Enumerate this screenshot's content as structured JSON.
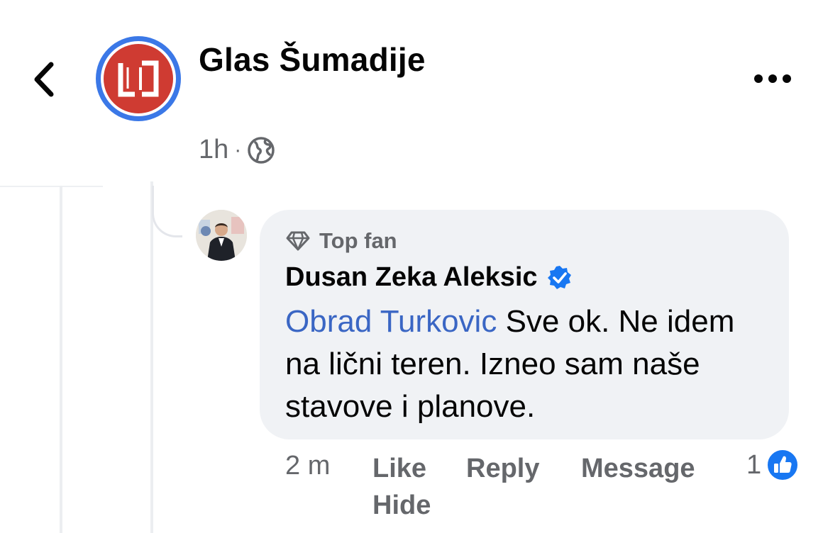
{
  "header": {
    "page_name": "Glas Šumadije",
    "timestamp": "1h",
    "separator": "·",
    "audience_icon": "globe-icon",
    "back_icon": "chevron-left-icon",
    "more_icon": "more-dots-icon"
  },
  "comment": {
    "badge_label": "Top fan",
    "badge_icon": "diamond-icon",
    "author": "Dusan Zeka Aleksic",
    "verified_icon": "verified-badge-icon",
    "mention": "Obrad Turkovic",
    "text": " Sve ok. Ne idem na lični teren. Izneo sam naše stavove i planove.",
    "time": "2 m",
    "actions": {
      "like": "Like",
      "reply": "Reply",
      "message": "Message",
      "hide": "Hide"
    },
    "like_count": "1",
    "like_icon": "thumbs-up-icon"
  },
  "colors": {
    "accent_blue": "#1877f2",
    "mention_blue": "#3a66c4",
    "logo_red": "#cf3b32",
    "secondary_text": "#65676b",
    "bubble_bg": "#f0f2f5"
  }
}
